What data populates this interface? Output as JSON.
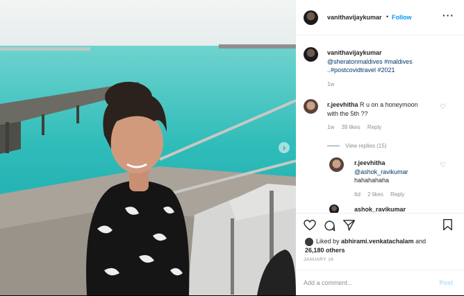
{
  "post": {
    "username": "vanithavijaykumar",
    "follow_label": "Follow",
    "more_icon": "more-options-icon"
  },
  "caption": {
    "username": "vanithavijaykumar",
    "line1": "@sheratonmaldives #maldives",
    "line2": "..#postcovidtravel #2021",
    "age": "1w"
  },
  "comments": [
    {
      "username": "r.jeevhitha",
      "text_a": "R u on a honeymoon",
      "text_b": "with the 5th ??",
      "age": "1w",
      "likes": "39 likes",
      "reply_label": "Reply",
      "view_replies": "View replies (15)"
    }
  ],
  "replies": [
    {
      "username": "r.jeevhitha",
      "mention": "@ashok_ravikumar",
      "text": "hahahahaha",
      "age": "6d",
      "likes": "2 likes",
      "reply_label": "Reply"
    },
    {
      "username": "ashok_ravikumar"
    }
  ],
  "likes": {
    "liked_by": "Liked by",
    "liker": "abhirami.venkatachalam",
    "and": "and",
    "others": "26,180 others"
  },
  "date": "JANUARY 16",
  "add_comment": {
    "placeholder": "Add a comment...",
    "post_label": "Post"
  },
  "colors": {
    "accent": "#0095f6",
    "link": "#00376b",
    "muted": "#8e8e8e",
    "sea": "#2fb9b8"
  }
}
